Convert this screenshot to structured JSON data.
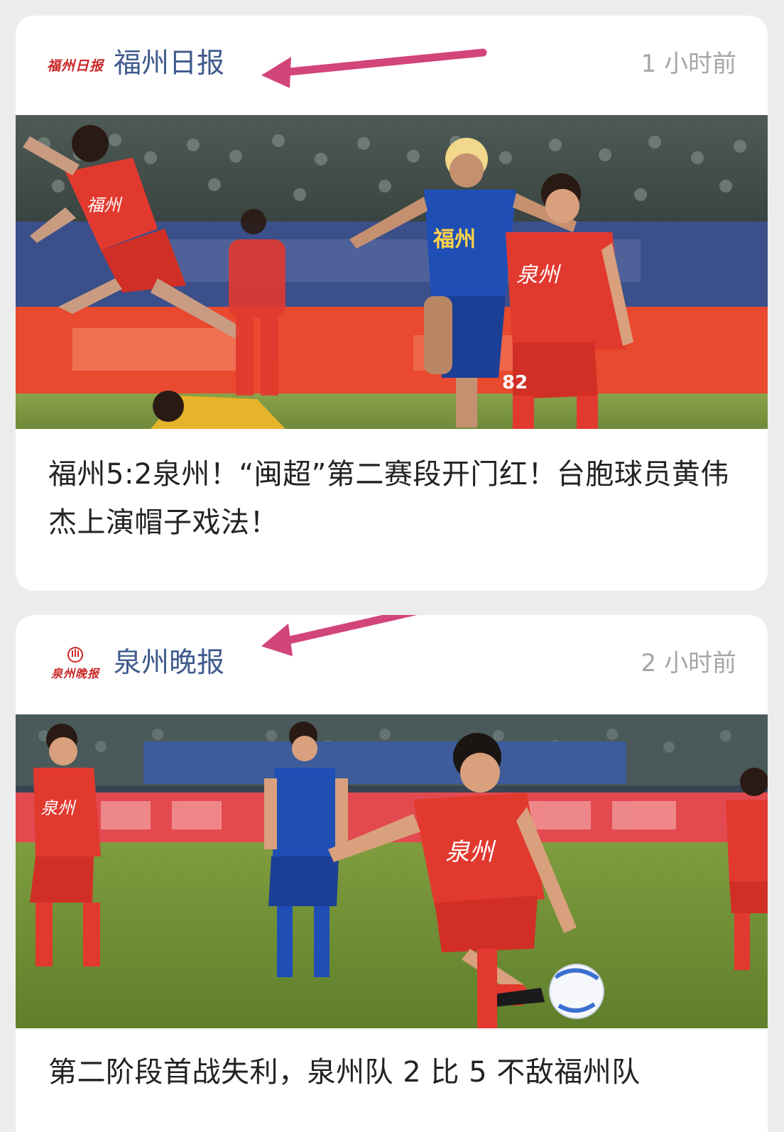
{
  "feed": {
    "items": [
      {
        "source_name": "福州日报",
        "source_logo_text": "福州日报",
        "time": "1 小时前",
        "headline": "福州5:2泉州！“闽超”第二赛段开门红！台胞球员黄伟杰上演帽子戏法！",
        "photo_jersey_texts": [
          "福州",
          "泉州",
          "82"
        ]
      },
      {
        "source_name": "泉州晚报",
        "source_logo_text": "泉州晚报",
        "time": "2 小时前",
        "headline": "第二阶段首战失利，泉州队 2 比 5 不敌福州队",
        "photo_jersey_texts": [
          "泉州",
          "泉州"
        ]
      }
    ]
  },
  "colors": {
    "background": "#ececec",
    "card": "#ffffff",
    "source_name": "#3f5a8c",
    "timestamp": "#a6a6a6",
    "arrow": "#d2457a",
    "team_red": "#e2392f",
    "team_blue": "#1f4fb5"
  },
  "icons": [
    "arrow-annotation",
    "fuzhou-daily-logo",
    "quanzhou-evening-logo"
  ]
}
